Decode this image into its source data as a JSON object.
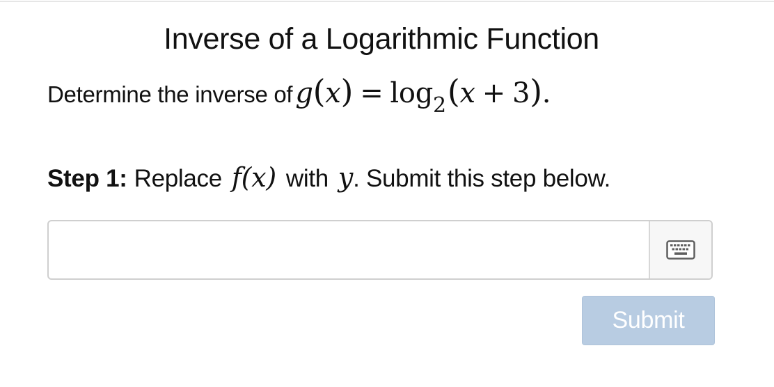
{
  "title": "Inverse of a Logarithmic Function",
  "prompt": {
    "text": "Determine the inverse of",
    "math": {
      "fn": "g",
      "lparen": "(",
      "arg": "x",
      "rparen": ")",
      "equals": "=",
      "log": "log",
      "base": "2",
      "inner_open": "(",
      "inner_var": "x",
      "plus": "+",
      "inner_const": "3",
      "inner_close": ")",
      "period": "."
    }
  },
  "step": {
    "label": "Step 1:",
    "text_before": "Replace",
    "math_fx": "f(x)",
    "text_with": "with",
    "math_y": "y",
    "text_after": ". Submit this step below."
  },
  "answer": {
    "value": "",
    "placeholder": ""
  },
  "submit_label": "Submit",
  "colors": {
    "submit_background": "#b8cce2",
    "input_border": "#cfcfcf"
  },
  "icons": {
    "keyboard": "keyboard-icon"
  }
}
